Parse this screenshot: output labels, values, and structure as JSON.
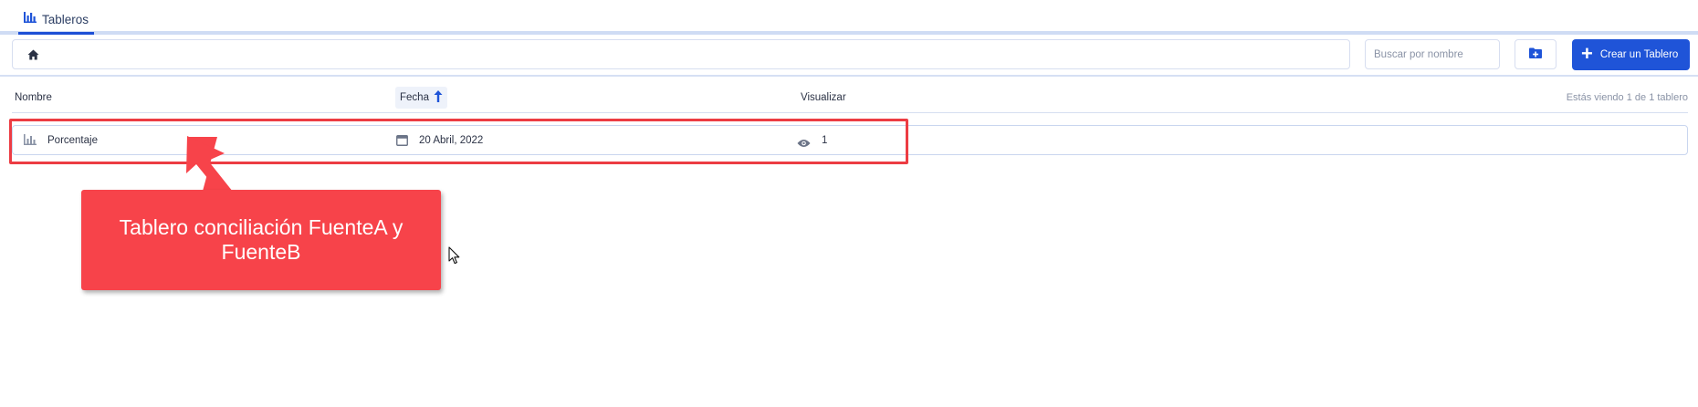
{
  "tabs": [
    {
      "label": "Tableros",
      "icon": "bar-chart-icon",
      "active": true
    }
  ],
  "toolbar": {
    "home_icon": "home-icon",
    "search_placeholder": "Buscar por nombre",
    "search_value": "",
    "new_folder_icon": "folder-plus-icon",
    "create_label": "Crear un Tablero"
  },
  "table": {
    "columns": {
      "name": "Nombre",
      "date": "Fecha",
      "views": "Visualizar"
    },
    "sort": {
      "column": "Fecha",
      "direction": "ascending"
    },
    "counter": "Estás viendo 1 de 1 tablero",
    "rows": [
      {
        "icon": "bar-chart-icon",
        "name": "Porcentaje",
        "date": "20 Abril, 2022",
        "views": "1"
      }
    ]
  },
  "annotation": {
    "text": "Tablero conciliación FuenteA y FuenteB",
    "color": "#f7434a"
  },
  "colors": {
    "accent": "#1f54d8",
    "border": "#d7def0",
    "annotation_border": "#ec3c43"
  }
}
